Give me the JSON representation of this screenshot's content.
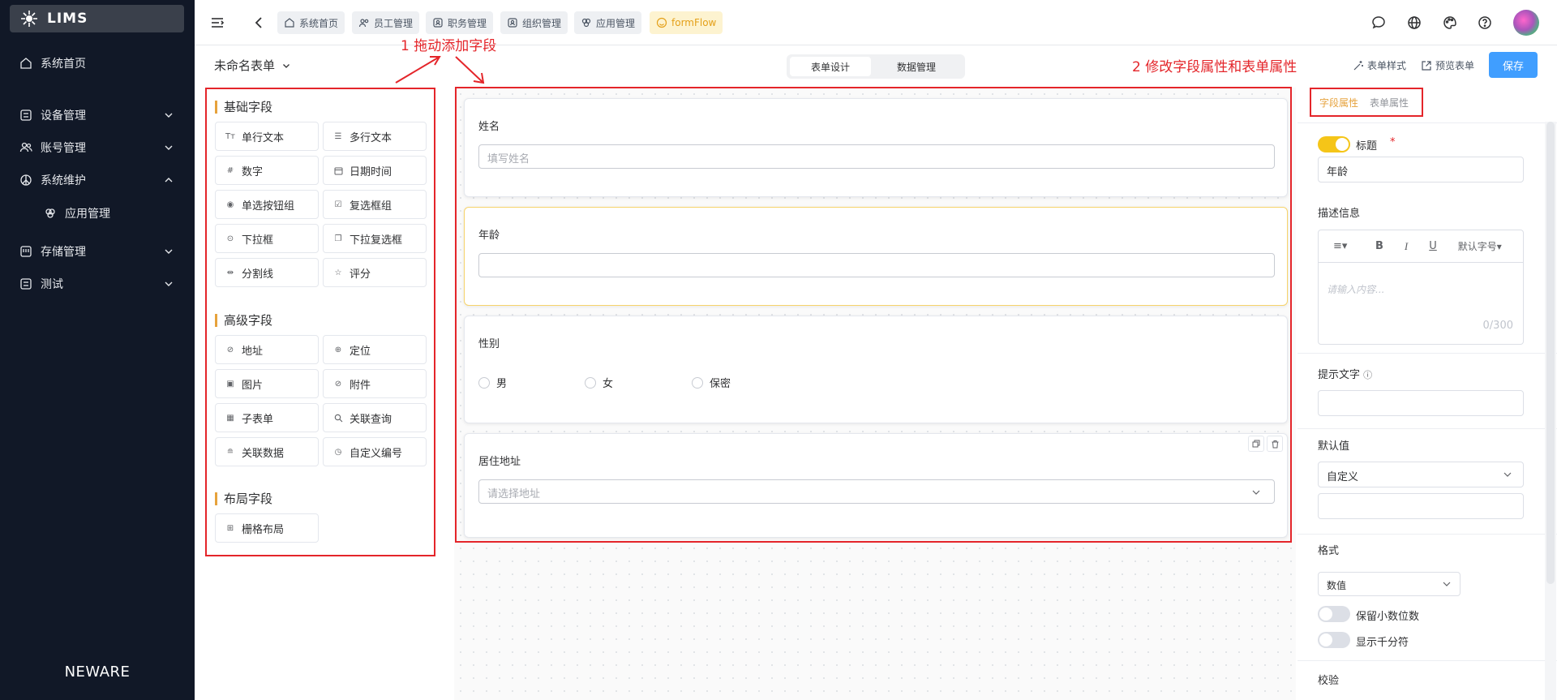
{
  "app": {
    "title": "LIMS",
    "footer_brand": "NEWARE"
  },
  "sidebar": {
    "items": [
      {
        "label": "系统首页"
      },
      {
        "label": "设备管理"
      },
      {
        "label": "账号管理"
      },
      {
        "label": "系统维护"
      },
      {
        "label": "应用管理"
      },
      {
        "label": "存储管理"
      },
      {
        "label": "测试"
      }
    ]
  },
  "tabs": [
    {
      "label": "系统首页"
    },
    {
      "label": "员工管理"
    },
    {
      "label": "职务管理"
    },
    {
      "label": "组织管理"
    },
    {
      "label": "应用管理"
    },
    {
      "label": "formFlow"
    }
  ],
  "header": {
    "form_name": "未命名表单",
    "seg_design": "表单设计",
    "seg_data": "数据管理",
    "form_style": "表单样式",
    "preview": "预览表单",
    "save": "保存"
  },
  "annotations": {
    "step1": "1 拖动添加字段",
    "step2": "2 修改字段属性和表单属性"
  },
  "palette": {
    "basic_title": "基础字段",
    "basic": [
      "单行文本",
      "多行文本",
      "数字",
      "日期时间",
      "单选按钮组",
      "复选框组",
      "下拉框",
      "下拉复选框",
      "分割线",
      "评分"
    ],
    "advanced_title": "高级字段",
    "advanced": [
      "地址",
      "定位",
      "图片",
      "附件",
      "子表单",
      "关联查询",
      "关联数据",
      "自定义编号"
    ],
    "layout_title": "布局字段",
    "layout": [
      "栅格布局"
    ]
  },
  "canvas": {
    "name_label": "姓名",
    "name_placeholder": "填写姓名",
    "age_label": "年龄",
    "gender_label": "性别",
    "gender_options": [
      "男",
      "女",
      "保密"
    ],
    "address_label": "居住地址",
    "address_placeholder": "请选择地址"
  },
  "panel": {
    "tab_field": "字段属性",
    "tab_form": "表单属性",
    "title_label": "标题",
    "required_mark": "*",
    "title_value": "年龄",
    "desc_label": "描述信息",
    "font_size": "默认字号",
    "desc_placeholder": "请输入内容...",
    "desc_count": "0/300",
    "hint_label": "提示文字",
    "default_label": "默认值",
    "default_value": "自定义",
    "format_label": "格式",
    "format_value": "数值",
    "keep_decimals": "保留小数位数",
    "thousands": "显示千分符",
    "validate_label": "校验"
  },
  "colors": {
    "accent": "#409eff",
    "warn": "#e6a23c",
    "annotation": "#e4252a",
    "sidebar_bg": "#111827"
  }
}
